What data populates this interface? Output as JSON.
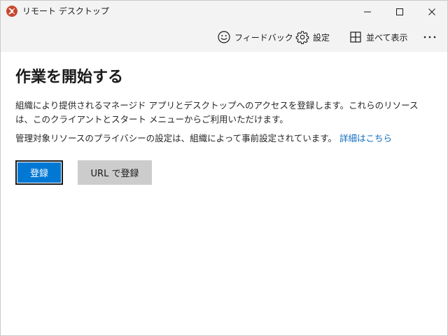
{
  "window": {
    "title": "リモート デスクトップ"
  },
  "toolbar": {
    "feedback_label": "フィードバック",
    "settings_label": "設定",
    "tile_label": "並べて表示",
    "more_label": "…"
  },
  "main": {
    "title": "作業を開始する",
    "description": "組織により提供されるマネージド アプリとデスクトップへのアクセスを登録します。これらのリソースは、このクライアントとスタート メニューからご利用いただけます。",
    "privacy_text": "管理対象リソースのプライバシーの設定は、組織によって事前設定されています。",
    "privacy_link": "詳細はこちら",
    "subscribe_button": "登録",
    "subscribe_url_button": "URL で登録"
  },
  "colors": {
    "accent": "#0078d4",
    "link": "#0f6cbd",
    "app_icon": "#c8472f",
    "chrome_bg": "#f3f3f3",
    "secondary_button": "#cccccc"
  },
  "icons": {
    "app": "remote-desktop-icon",
    "feedback": "smiley-icon",
    "settings": "gear-icon",
    "tile": "grid-icon",
    "more": "more-icon",
    "minimize": "minimize-icon",
    "maximize": "maximize-icon",
    "close": "close-icon"
  }
}
